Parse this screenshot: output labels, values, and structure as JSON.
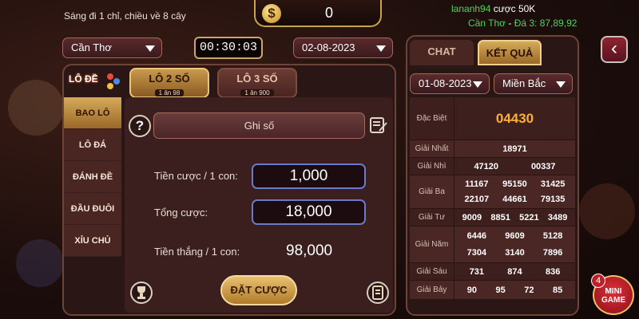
{
  "header": {
    "hint": "Sáng đi 1 chỉ, chiều về 8 cây",
    "coin_symbol": "$",
    "balance": "0",
    "ticker_user": "lananh94",
    "ticker_action": " cược 50K",
    "ticker_city": "Cần Thơ",
    "ticker_sep": " - ",
    "ticker_result": "Đá 3: 87,89,92",
    "exit_icon": "‹"
  },
  "controls": {
    "region": "Cần Thơ",
    "timer": "00:30:03",
    "date": "02-08-2023"
  },
  "logo": {
    "text": "LÔ ĐỀ"
  },
  "tabs": [
    {
      "label": "LÔ 2 SỐ",
      "sub": "1 ăn 98"
    },
    {
      "label": "LÔ 3 SỐ",
      "sub": "1 ăn 900"
    }
  ],
  "sidebar": {
    "items": [
      "BAO LÔ",
      "LÔ ĐÁ",
      "ĐÁNH ĐỀ",
      "ĐẦU ĐUÔI",
      "XỈU CHỦ"
    ]
  },
  "form": {
    "help": "?",
    "ghi_so": "Ghi số",
    "label_bet": "Tiền cược / 1 con:",
    "value_bet": "1,000",
    "label_total": "Tổng cược:",
    "value_total": "18,000",
    "label_win": "Tiền thắng / 1 con:",
    "value_win": "98,000",
    "submit": "ĐẶT CƯỢC"
  },
  "results": {
    "tab_chat": "CHAT",
    "tab_result": "KẾT QUẢ",
    "date": "01-08-2023",
    "region": "Miền Bắc",
    "rows": [
      {
        "name": "Đặc Biệt",
        "values": [
          "04430"
        ]
      },
      {
        "name": "Giải Nhất",
        "values": [
          "18971"
        ]
      },
      {
        "name": "Giải Nhì",
        "values": [
          "47120",
          "00337"
        ]
      },
      {
        "name": "Giải Ba",
        "values": [
          "11167",
          "95150",
          "31425",
          "22107",
          "44661",
          "79135"
        ]
      },
      {
        "name": "Giải Tư",
        "values": [
          "9009",
          "8851",
          "5221",
          "3489"
        ]
      },
      {
        "name": "Giải Năm",
        "values": [
          "6446",
          "9609",
          "5128",
          "7304",
          "3140",
          "7896"
        ]
      },
      {
        "name": "Giải Sáu",
        "values": [
          "731",
          "874",
          "836"
        ]
      },
      {
        "name": "Giải Bảy",
        "values": [
          "90",
          "95",
          "72",
          "85"
        ]
      }
    ]
  },
  "mini_game": {
    "label_1": "MINI",
    "label_2": "GAME",
    "badge": "4"
  },
  "colors": {
    "accent_gold": "#d6aa5a",
    "special_prize": "#ffb030",
    "ticker_green": "#4cd65a"
  }
}
